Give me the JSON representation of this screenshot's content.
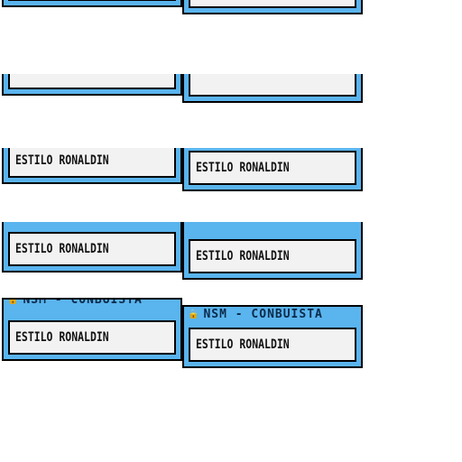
{
  "cards": {
    "label": "ESTILO RONALDIN",
    "header": "NSM - CONBUISTA"
  },
  "colors": {
    "card_blue": "#5ab4ee",
    "inner_bg": "#f2f2f2",
    "border": "#000000",
    "header_text": "#0b2a4a"
  },
  "icons": {
    "header_icon": "lock-icon"
  }
}
